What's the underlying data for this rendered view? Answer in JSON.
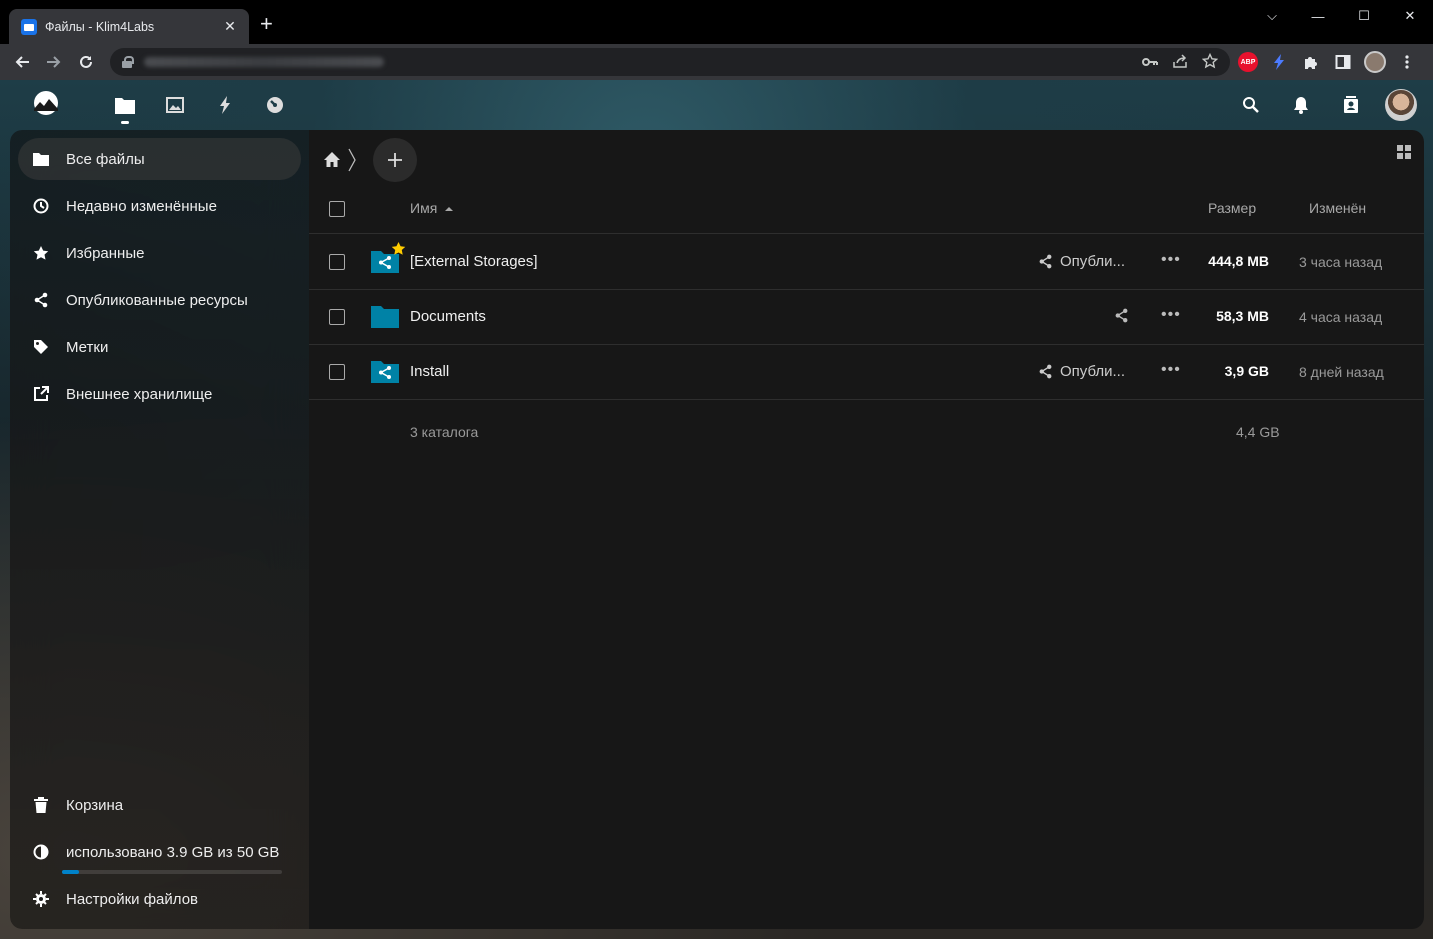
{
  "browser": {
    "tab_title": "Файлы - Klim4Labs",
    "tab_close": "✕",
    "new_tab": "+",
    "win_min": "—",
    "win_max": "☐",
    "win_close": "✕",
    "win_chevron": "⌵"
  },
  "nav": {
    "items": [
      {
        "label": "Все файлы",
        "icon": "folder-icon"
      },
      {
        "label": "Недавно изменённые",
        "icon": "clock-icon"
      },
      {
        "label": "Избранные",
        "icon": "star-icon"
      },
      {
        "label": "Опубликованные ресурсы",
        "icon": "share-icon"
      },
      {
        "label": "Метки",
        "icon": "tag-icon"
      },
      {
        "label": "Внешнее хранилище",
        "icon": "external-link-icon"
      }
    ],
    "trash": "Корзина",
    "quota": "использовано 3.9 GB из 50 GB",
    "quota_fraction": 0.078,
    "settings": "Настройки файлов"
  },
  "table": {
    "header_name": "Имя",
    "header_size": "Размер",
    "header_modified": "Изменён",
    "rows": [
      {
        "name": "[External Storages]",
        "shared_label": "Опубли...",
        "size": "444,8 MB",
        "modified": "3 часа назад",
        "favorite": true,
        "shared_folder": true
      },
      {
        "name": "Documents",
        "shared_label": "",
        "size": "58,3 MB",
        "modified": "4 часа назад",
        "favorite": false,
        "shared_folder": false
      },
      {
        "name": "Install",
        "shared_label": "Опубли...",
        "size": "3,9 GB",
        "modified": "8 дней назад",
        "favorite": false,
        "shared_folder": true
      }
    ],
    "summary_count": "3 каталога",
    "summary_size": "4,4 GB"
  },
  "colors": {
    "accent": "#0082c9",
    "folder": "#0082a6",
    "favorite": "#fc0"
  }
}
